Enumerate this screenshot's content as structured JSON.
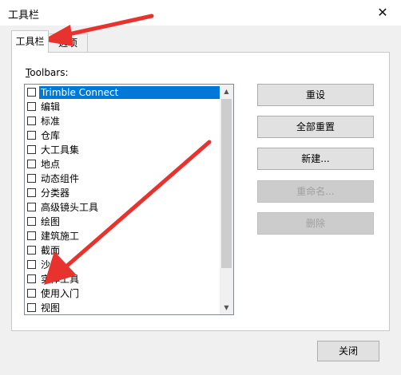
{
  "window": {
    "title": "工具栏",
    "close_glyph": "✕"
  },
  "tabs": [
    {
      "label": "工具栏",
      "active": true
    },
    {
      "label": "选项",
      "active": false
    }
  ],
  "toolbars": {
    "label_accel": "T",
    "label_rest": "oolbars:",
    "items": [
      {
        "label": "Trimble Connect",
        "checked": false,
        "selected": true
      },
      {
        "label": "编辑",
        "checked": false
      },
      {
        "label": "标准",
        "checked": false
      },
      {
        "label": "仓库",
        "checked": false
      },
      {
        "label": "大工具集",
        "checked": false
      },
      {
        "label": "地点",
        "checked": false
      },
      {
        "label": "动态组件",
        "checked": false
      },
      {
        "label": "分类器",
        "checked": false
      },
      {
        "label": "高级镜头工具",
        "checked": false
      },
      {
        "label": "绘图",
        "checked": false
      },
      {
        "label": "建筑施工",
        "checked": false
      },
      {
        "label": "截面",
        "checked": false
      },
      {
        "label": "沙箱",
        "checked": false
      },
      {
        "label": "实体工具",
        "checked": false
      },
      {
        "label": "使用入门",
        "checked": false
      },
      {
        "label": "视图",
        "checked": false
      }
    ]
  },
  "buttons": {
    "reset": "重设",
    "reset_all": "全部重置",
    "new": "新建...",
    "rename": "重命名...",
    "delete": "删除",
    "close": "关闭"
  },
  "colors": {
    "selection": "#0078d7",
    "annotation_arrow": "#e8322e"
  }
}
